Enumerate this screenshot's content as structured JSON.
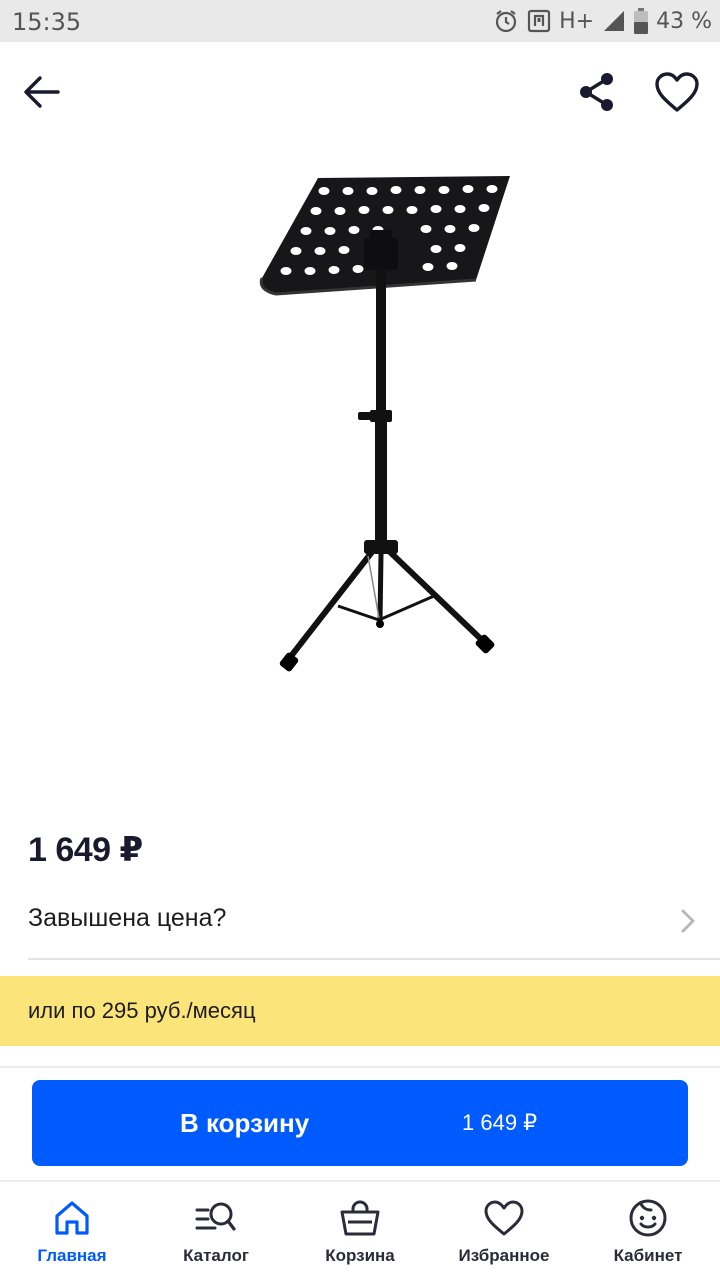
{
  "status_bar": {
    "time": "15:35",
    "network": "H+",
    "battery": "43 %"
  },
  "header": {
    "icons": [
      "arrow-left-icon",
      "share-icon",
      "heart-icon"
    ]
  },
  "product": {
    "image": "music-stand-image",
    "price": "1 649 ₽",
    "price_report_label": "Завышена цена?",
    "installment_text": "или по 295 руб./месяц"
  },
  "cart_button": {
    "label": "В корзину",
    "price": "1 649 ₽"
  },
  "bottom_nav": {
    "items": [
      {
        "label": "Главная",
        "icon": "home-icon",
        "active": true
      },
      {
        "label": "Каталог",
        "icon": "catalog-search-icon",
        "active": false
      },
      {
        "label": "Корзина",
        "icon": "basket-icon",
        "active": false
      },
      {
        "label": "Избранное",
        "icon": "heart-icon",
        "active": false
      },
      {
        "label": "Кабинет",
        "icon": "profile-icon",
        "active": false
      }
    ]
  },
  "colors": {
    "accent": "#005bff",
    "installment_bg": "#fbe57a",
    "status_bar_bg": "#e9e9e9"
  }
}
